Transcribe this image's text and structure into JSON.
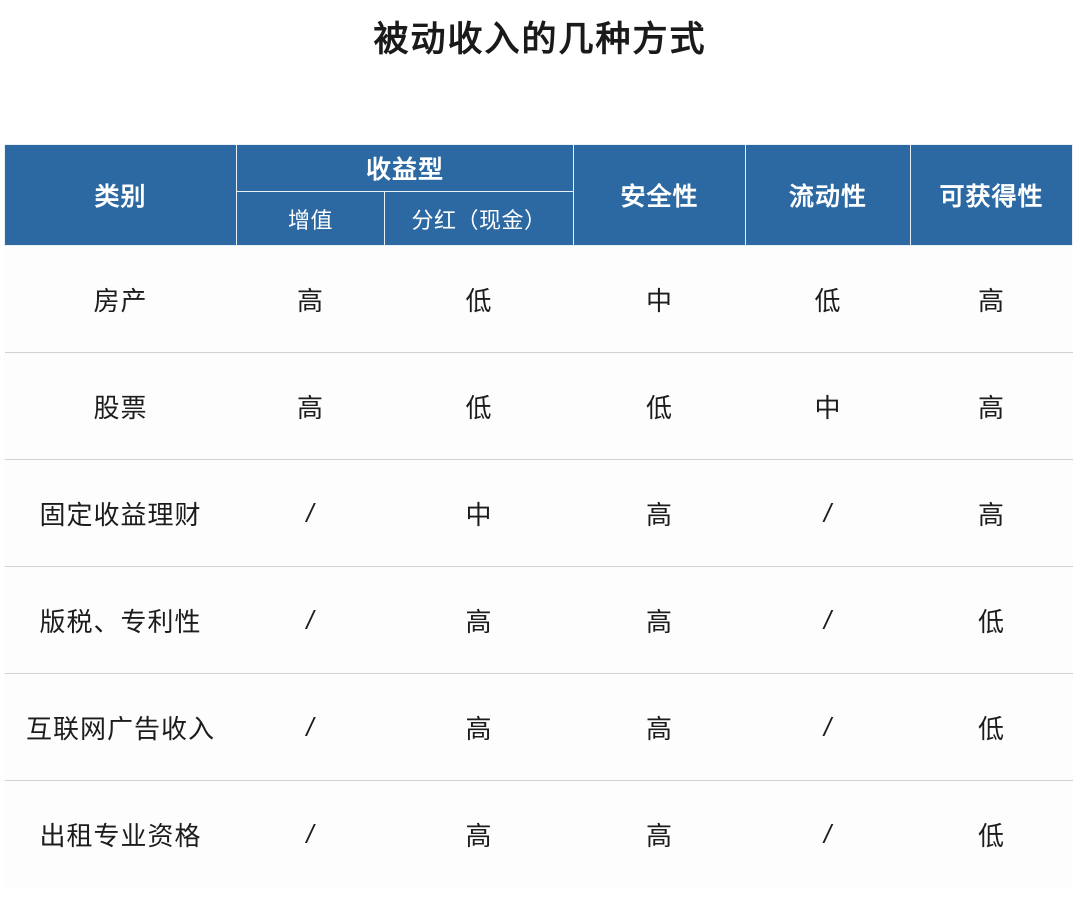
{
  "page": {
    "title": "被动收入的几种方式",
    "accent_color": "#2c69a2",
    "header_text_color": "#ffffff",
    "body_bg_color": "#fdfdfd",
    "row_divider_color": "#d2d2d2",
    "body_text_color": "#1c1c1c"
  },
  "table": {
    "header": {
      "category": "类别",
      "return_group": "收益型",
      "appreciation": "增值",
      "dividend": "分红（现金）",
      "safety": "安全性",
      "liquidity": "流动性",
      "accessibility": "可获得性"
    },
    "rows": [
      {
        "category": "房产",
        "appreciation": "高",
        "dividend": "低",
        "safety": "中",
        "liquidity": "低",
        "accessibility": "高"
      },
      {
        "category": "股票",
        "appreciation": "高",
        "dividend": "低",
        "safety": "低",
        "liquidity": "中",
        "accessibility": "高"
      },
      {
        "category": "固定收益理财",
        "appreciation": "/",
        "dividend": "中",
        "safety": "高",
        "liquidity": "/",
        "accessibility": "高"
      },
      {
        "category": "版税、专利性",
        "appreciation": "/",
        "dividend": "高",
        "safety": "高",
        "liquidity": "/",
        "accessibility": "低"
      },
      {
        "category": "互联网广告收入",
        "appreciation": "/",
        "dividend": "高",
        "safety": "高",
        "liquidity": "/",
        "accessibility": "低"
      },
      {
        "category": "出租专业资格",
        "appreciation": "/",
        "dividend": "高",
        "safety": "高",
        "liquidity": "/",
        "accessibility": "低"
      }
    ]
  },
  "chart_data": {
    "type": "table",
    "title": "被动收入的几种方式",
    "columns": [
      "类别",
      "增值",
      "分红（现金）",
      "安全性",
      "流动性",
      "可获得性"
    ],
    "column_groups": [
      {
        "label": "类别",
        "span": 1
      },
      {
        "label": "收益型",
        "span": 2
      },
      {
        "label": "安全性",
        "span": 1
      },
      {
        "label": "流动性",
        "span": 1
      },
      {
        "label": "可获得性",
        "span": 1
      }
    ],
    "rows": [
      [
        "房产",
        "高",
        "低",
        "中",
        "低",
        "高"
      ],
      [
        "股票",
        "高",
        "低",
        "低",
        "中",
        "高"
      ],
      [
        "固定收益理财",
        "/",
        "中",
        "高",
        "/",
        "高"
      ],
      [
        "版税、专利性",
        "/",
        "高",
        "高",
        "/",
        "低"
      ],
      [
        "互联网广告收入",
        "/",
        "高",
        "高",
        "/",
        "低"
      ],
      [
        "出租专业资格",
        "/",
        "高",
        "高",
        "/",
        "低"
      ]
    ]
  }
}
